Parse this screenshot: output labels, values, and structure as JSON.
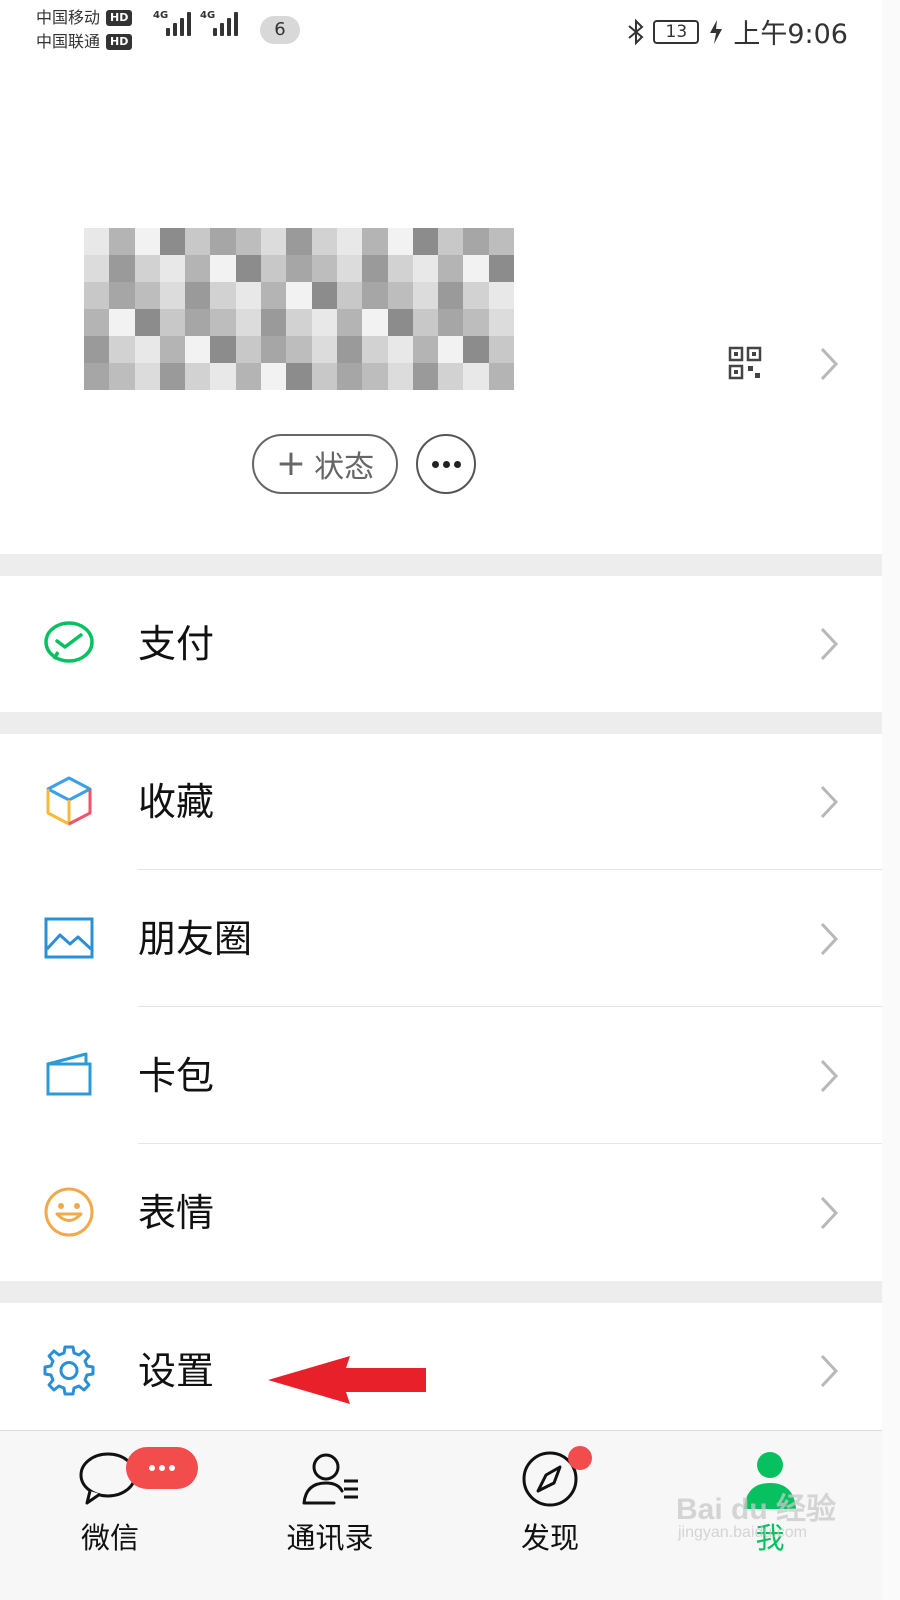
{
  "status_bar": {
    "carrier1": "中国移动",
    "carrier2": "中国联通",
    "hd": "HD",
    "network": "4G",
    "notification_count": "6",
    "battery": "13",
    "time": "上午9:06"
  },
  "profile": {
    "status_button": "状态",
    "plus": "+"
  },
  "menu": {
    "pay": "支付",
    "favorites": "收藏",
    "moments": "朋友圈",
    "cards": "卡包",
    "stickers": "表情",
    "settings": "设置"
  },
  "tabbar": {
    "chats": "微信",
    "contacts": "通讯录",
    "discover": "发现",
    "me": "我"
  },
  "watermark": {
    "brand": "Bai du 经验",
    "url": "jingyan.baidu.com"
  },
  "colors": {
    "accent": "#07c160",
    "badge": "#f24c4c",
    "annotation_arrow": "#e8202a",
    "section_gap": "#ededed"
  },
  "icons": {
    "pay": "wechat-pay-icon",
    "favorites": "cube-icon",
    "moments": "image-icon",
    "cards": "card-wallet-icon",
    "stickers": "smiley-icon",
    "settings": "gear-icon"
  }
}
